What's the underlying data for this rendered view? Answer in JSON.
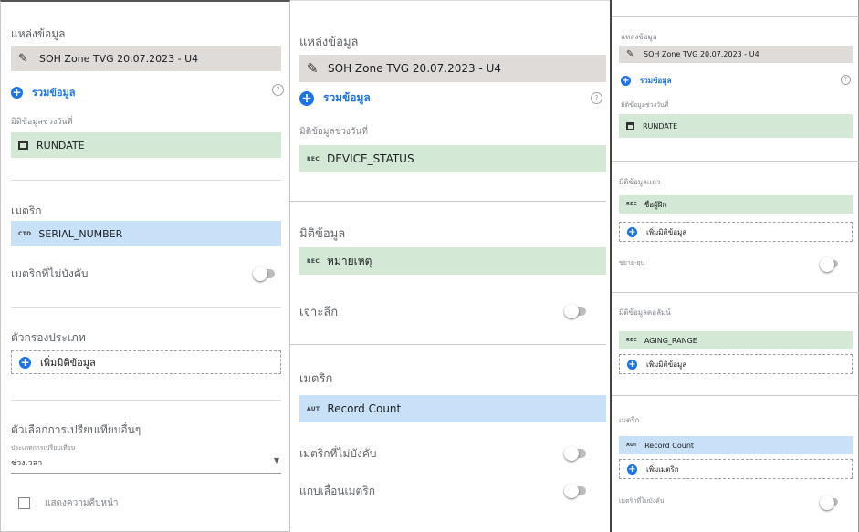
{
  "panel1": {
    "data_source_title": "แหล่งข้อมูล",
    "data_source_value": "SOH Zone TVG 20.07.2023 - U4",
    "blend_label": "รวมข้อมูล",
    "help_glyph": "?",
    "date_range_dim_title": "มิติข้อมูลช่วงวันที่",
    "date_range_dim_tag": "CAL",
    "date_range_dim_value": "RUNDATE",
    "metric_title": "เมตริก",
    "metric_tag": "CTD",
    "metric_value": "SERIAL_NUMBER",
    "optional_metrics_label": "เมตริกที่ไม่บังคับ",
    "filter_title": "ตัวกรองประเภท",
    "add_dimension_label": "เพิ่มมิติข้อมูล",
    "comparison_title": "ตัวเลือกการเปรียบเทียบอื่นๆ",
    "comparison_type_label": "ประเภทการเปรียบเทียบ",
    "comparison_type_value": "ช่วงเวลา",
    "checkbox_label": "แสดงความคืบหน้า"
  },
  "panel2": {
    "data_source_title": "แหล่งข้อมูล",
    "data_source_value": "SOH Zone TVG 20.07.2023 - U4",
    "blend_label": "รวมข้อมูล",
    "help_glyph": "?",
    "date_range_dim_title": "มิติข้อมูลช่วงวันที่",
    "date_range_dim_tag": "REC",
    "date_range_dim_value": "DEVICE_STATUS",
    "dimension_title": "มิติข้อมูล",
    "dimension_tag": "REC",
    "dimension_value": "หมายเหตุ",
    "drilldown_label": "เจาะลึก",
    "metric_title": "เมตริก",
    "metric_tag": "AUT",
    "metric_value": "Record Count",
    "optional_metrics_label": "เมตริกที่ไม่บังคับ",
    "metric_slider_label": "แถบเลื่อนเมตริก"
  },
  "panel3": {
    "data_source_title": "แหล่งข้อมูล",
    "data_source_value": "SOH Zone TVG 20.07.2023 - U4",
    "blend_label": "รวมข้อมูล",
    "help_glyph": "?",
    "date_range_dim_title": "มิติข้อมูลช่วงวันที่",
    "date_range_dim_tag": "CAL",
    "date_range_dim_value": "RUNDATE",
    "row_dim_title": "มิติข้อมูลแถว",
    "row_dim_tag": "REC",
    "row_dim_value": "ชื่อผู้ฝึก",
    "add_dimension_label": "เพิ่มมิติข้อมูล",
    "expand_collapse_label": "ขยาย-ยุบ",
    "column_dim_title": "มิติข้อมูลคอลัมน์",
    "column_dim_tag": "REC",
    "column_dim_value": "AGING_RANGE",
    "add_dimension_label_2": "เพิ่มมิติข้อมูล",
    "metric_title": "เมตริก",
    "metric_tag": "AUT",
    "metric_value": "Record Count",
    "add_metric_label": "เพิ่มเมตริก",
    "optional_metrics_label": "เมตริกที่ไม่บังคับ"
  },
  "colors": {
    "green_field": "#d3e9d5",
    "blue_field": "#c9e1f8",
    "gray_field": "#dedbd8",
    "accent": "#1a73e8"
  }
}
